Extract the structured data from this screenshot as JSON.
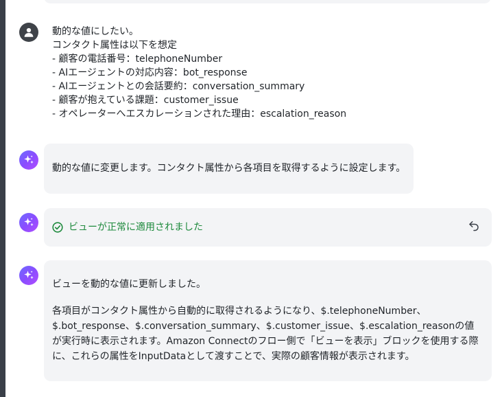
{
  "user_message": {
    "lines": [
      "動的な値にしたい。",
      "コンタクト属性は以下を想定",
      "- 顧客の電話番号：telephoneNumber",
      "- AIエージェントの対応内容：bot_response",
      "- AIエージェントとの会話要約：conversation_summary",
      "- 顧客が抱えている課題：customer_issue",
      "- オペレーターへエスカレーションされた理由：escalation_reason"
    ]
  },
  "assistant_messages": [
    {
      "text": "動的な値に変更します。コンタクト属性から各項目を取得するように設定します。"
    },
    {
      "status_text": "ビューが正常に適用されました",
      "status_icon": "check-circle-icon",
      "undo_icon": "undo-icon"
    },
    {
      "paragraph1": "ビューを動的な値に更新しました。",
      "paragraph2": "各項目がコンタクト属性から自動的に取得されるようになり、$.telephoneNumber、$.bot_response、$.conversation_summary、$.customer_issue、$.escalation_reasonの値が実行時に表示されます。Amazon Connectのフロー側で「ビューを表示」ブロックを使用する際に、これらの属性をInputDataとして渡すことで、実際の顧客情報が表示されます。"
    }
  ],
  "colors": {
    "success": "#1e8a3d",
    "bubble_bg": "#f3f4f6",
    "user_avatar": "#3f4349",
    "ai_gradient_start": "#6e6cff",
    "ai_gradient_end": "#b14dff"
  }
}
